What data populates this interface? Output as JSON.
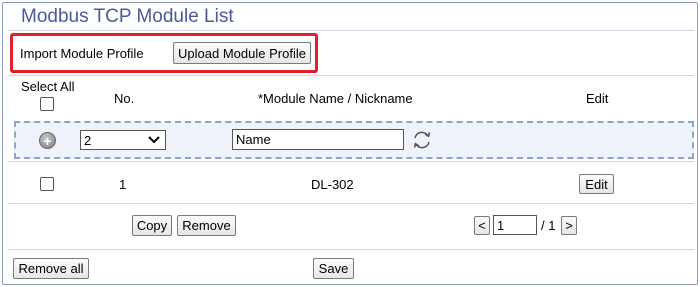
{
  "header": {
    "title": "Modbus TCP Module List"
  },
  "import": {
    "label": "Import Module Profile",
    "upload_button": "Upload Module Profile"
  },
  "table": {
    "headers": {
      "select_all": "Select All",
      "no": "No.",
      "module_name": "*Module Name / Nickname",
      "edit": "Edit"
    },
    "new_row": {
      "selected_no": "2",
      "name_value": "Name"
    },
    "rows": [
      {
        "no": "1",
        "name": "DL-302",
        "edit_label": "Edit"
      }
    ]
  },
  "actions": {
    "copy": "Copy",
    "remove": "Remove",
    "remove_all": "Remove all",
    "save": "Save"
  },
  "pagination": {
    "prev": "<",
    "page": "1",
    "total": "/ 1",
    "next": ">"
  },
  "colors": {
    "title": "#4a5a99",
    "highlight": "#e0202a",
    "dashed_border": "#8fa3c8"
  },
  "icons": {
    "add": "plus-circle-icon",
    "refresh": "refresh-icon",
    "dropdown": "chevron-down-icon"
  }
}
